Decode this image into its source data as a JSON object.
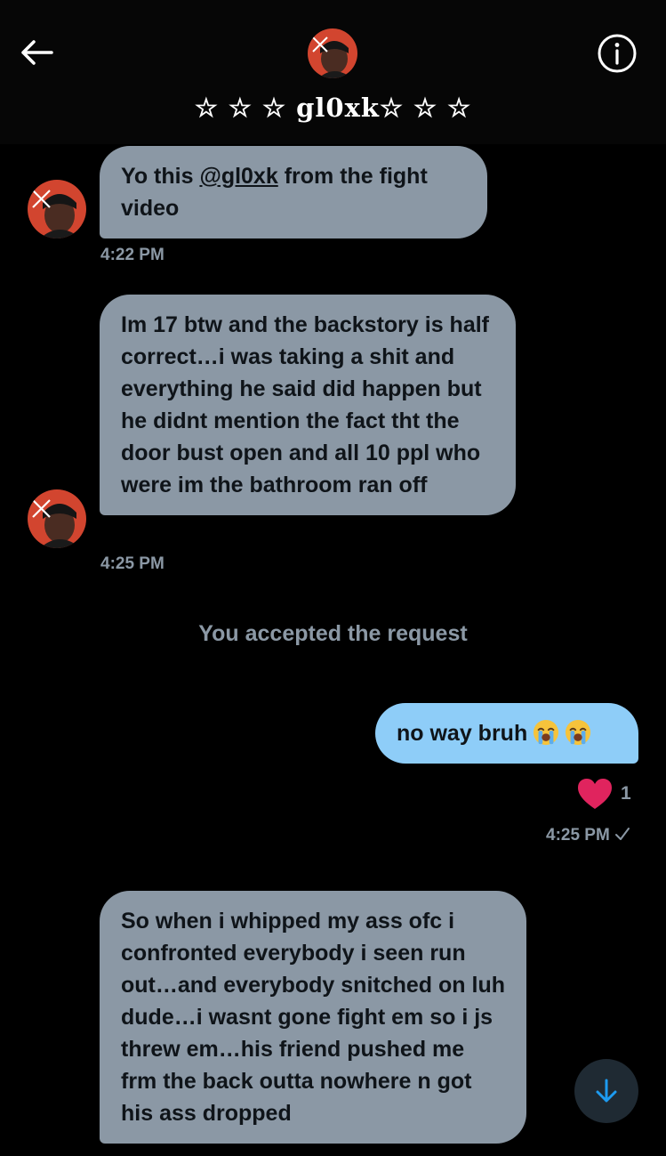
{
  "header": {
    "title": "☆ ☆ ☆ gl0xk☆ ☆ ☆",
    "back_icon": "arrow-left-icon",
    "info_icon": "info-icon"
  },
  "messages": [
    {
      "direction": "incoming",
      "text_before": "Yo this ",
      "mention": "@gl0xk",
      "text_after": " from the fight video",
      "time": "4:22 PM"
    },
    {
      "direction": "incoming",
      "text": "Im 17 btw and the backstory is half correct…i was taking a shit and everything he said did happen but he didnt mention the fact tht the door bust open and all 10 ppl who were im the bathroom ran off",
      "time": "4:25 PM"
    },
    {
      "direction": "outgoing",
      "text": "no way bruh",
      "emojis": [
        "loudly-crying-face-emoji",
        "loudly-crying-face-emoji"
      ],
      "reaction": {
        "icon": "heart-icon",
        "count": "1"
      },
      "time": "4:25 PM",
      "status_icon": "checkmark-icon"
    },
    {
      "direction": "incoming",
      "text": "So when i whipped my ass ofc i confronted everybody i seen run out…and everybody snitched on luh dude…i wasnt gone fight em so i js threw em…his friend pushed me frm the back outta nowhere n got his ass dropped"
    }
  ],
  "system_note": "You accepted the request",
  "scroll_button": {
    "icon": "arrow-down-icon"
  },
  "colors": {
    "background": "#000000",
    "incoming_bubble": "#8b98a5",
    "outgoing_bubble": "#8ecdf8",
    "bubble_text": "#0f1419",
    "secondary_text": "#8b98a5",
    "heart": "#e0245e",
    "accent": "#1d9bf0"
  }
}
